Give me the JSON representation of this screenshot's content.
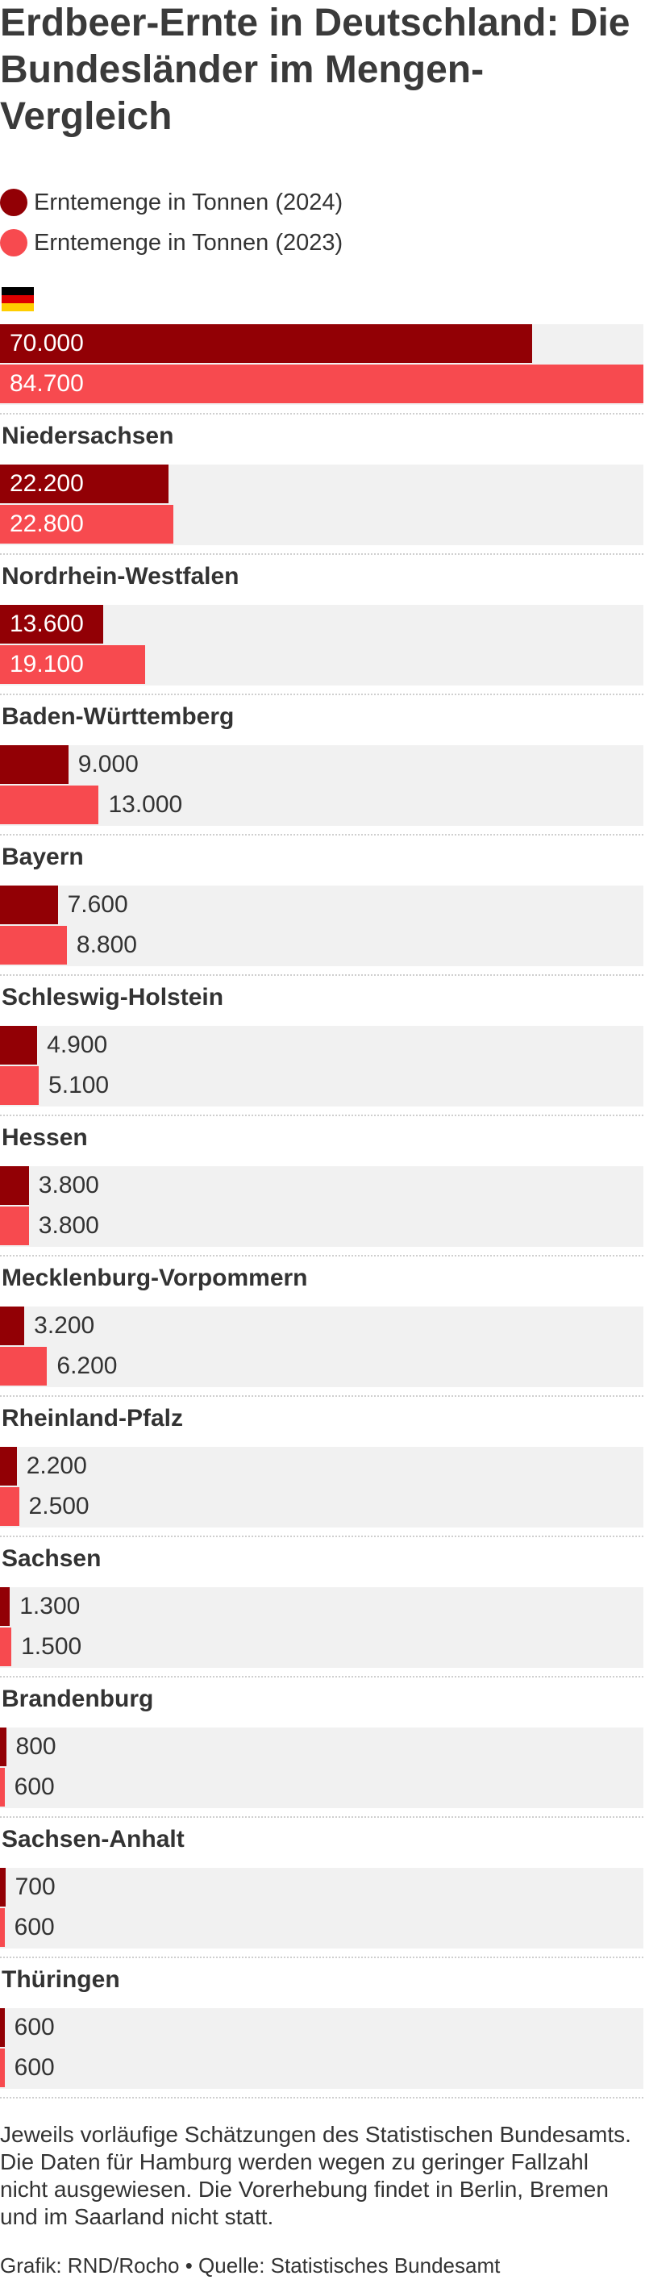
{
  "chart_data": {
    "type": "bar",
    "orientation": "horizontal",
    "title": "Erdbeer-Ernte in Deutschland: Die Bundesländer im Mengen-Vergleich",
    "legend": {
      "placement": "top-left"
    },
    "series": [
      {
        "name": "Erntemenge in Tonnen (2024)",
        "color": "#920005"
      },
      {
        "name": "Erntemenge in Tonnen (2023)",
        "color": "#f74a4f"
      }
    ],
    "xlim": [
      0,
      84700
    ],
    "groups": [
      {
        "label": "",
        "icon": "germany-flag-icon",
        "values": [
          70000,
          84700
        ],
        "display": [
          "70.000",
          "84.700"
        ]
      },
      {
        "label": "Niedersachsen",
        "values": [
          22200,
          22800
        ],
        "display": [
          "22.200",
          "22.800"
        ]
      },
      {
        "label": "Nordrhein-Westfalen",
        "values": [
          13600,
          19100
        ],
        "display": [
          "13.600",
          "19.100"
        ]
      },
      {
        "label": "Baden-Württemberg",
        "values": [
          9000,
          13000
        ],
        "display": [
          "9.000",
          "13.000"
        ]
      },
      {
        "label": "Bayern",
        "values": [
          7600,
          8800
        ],
        "display": [
          "7.600",
          "8.800"
        ]
      },
      {
        "label": "Schleswig-Holstein",
        "values": [
          4900,
          5100
        ],
        "display": [
          "4.900",
          "5.100"
        ]
      },
      {
        "label": "Hessen",
        "values": [
          3800,
          3800
        ],
        "display": [
          "3.800",
          "3.800"
        ]
      },
      {
        "label": "Mecklenburg-Vorpommern",
        "values": [
          3200,
          6200
        ],
        "display": [
          "3.200",
          "6.200"
        ]
      },
      {
        "label": "Rheinland-Pfalz",
        "values": [
          2200,
          2500
        ],
        "display": [
          "2.200",
          "2.500"
        ]
      },
      {
        "label": "Sachsen",
        "values": [
          1300,
          1500
        ],
        "display": [
          "1.300",
          "1.500"
        ]
      },
      {
        "label": "Brandenburg",
        "values": [
          800,
          600
        ],
        "display": [
          "800",
          "600"
        ]
      },
      {
        "label": "Sachsen-Anhalt",
        "values": [
          700,
          600
        ],
        "display": [
          "700",
          "600"
        ]
      },
      {
        "label": "Thüringen",
        "values": [
          600,
          600
        ],
        "display": [
          "600",
          "600"
        ]
      }
    ]
  },
  "footnote": "Jeweils vorläufige Schätzungen des Statistischen Bundesamts. Die Daten für Hamburg werden wegen zu geringer Fallzahl nicht ausgewiesen. Die Vorerhebung findet in Berlin, Bremen und im Saarland nicht statt.",
  "source": "Grafik: RND/Rocho • Quelle: Statistisches Bundesamt",
  "flag_colors": [
    "#000000",
    "#dd0000",
    "#ffce00"
  ]
}
